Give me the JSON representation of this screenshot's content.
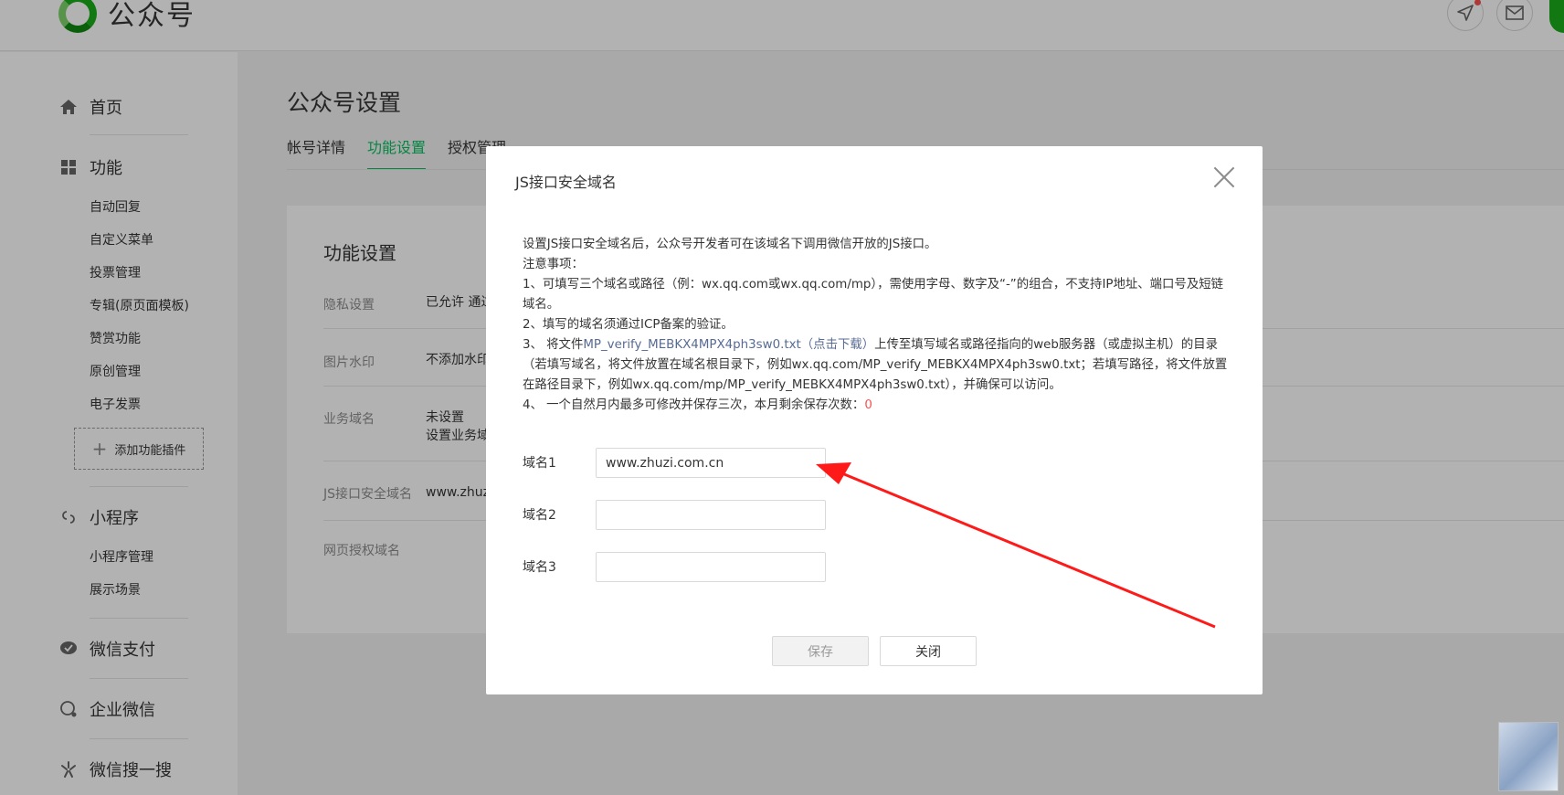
{
  "header": {
    "logo_text": "公众号",
    "icons": [
      "send-icon",
      "mail-icon"
    ]
  },
  "sidebar": {
    "sections": [
      {
        "label": "首页",
        "icon": "home-icon"
      },
      {
        "label": "功能",
        "icon": "grid-icon",
        "items": [
          "自动回复",
          "自定义菜单",
          "投票管理",
          "专辑(原页面模板)",
          "赞赏功能",
          "原创管理",
          "电子发票"
        ]
      },
      {
        "label": "小程序",
        "icon": "link-icon",
        "items": [
          "小程序管理",
          "展示场景"
        ]
      },
      {
        "label": "微信支付",
        "icon": "pay-icon"
      },
      {
        "label": "企业微信",
        "icon": "chat-icon"
      },
      {
        "label": "微信搜一搜",
        "icon": "search-star-icon"
      }
    ],
    "add_plugin_label": "添加功能插件"
  },
  "main": {
    "title": "公众号设置",
    "tabs": [
      "帐号详情",
      "功能设置",
      "授权管理"
    ],
    "active_tab": 1,
    "panel_title": "功能设置",
    "rows": [
      {
        "label": "隐私设置",
        "value": "已允许 通过"
      },
      {
        "label": "图片水印",
        "value": "不添加水印"
      },
      {
        "label": "业务域名",
        "value": "未设置",
        "value2": "设置业务域"
      },
      {
        "label": "JS接口安全域名",
        "value": "www.zhuz"
      },
      {
        "label": "网页授权域名",
        "value": ""
      }
    ]
  },
  "dialog": {
    "title": "JS接口安全域名",
    "intro": "设置JS接口安全域名后，公众号开发者可在该域名下调用微信开放的JS接口。",
    "notes_heading": "注意事项：",
    "note1": "1、可填写三个域名或路径（例：wx.qq.com或wx.qq.com/mp），需使用字母、数字及“-”的组合，不支持IP地址、端口号及短链域名。",
    "note2": "2、填写的域名须通过ICP备案的验证。",
    "note3_prefix": "3、 将文件",
    "note3_file": "MP_verify_MEBKX4MPX4ph3sw0.txt（点击下载）",
    "note3_suffix": "上传至填写域名或路径指向的web服务器（或虚拟主机）的目录（若填写域名，将文件放置在域名根目录下，例如wx.qq.com/MP_verify_MEBKX4MPX4ph3sw0.txt；若填写路径，将文件放置在路径目录下，例如wx.qq.com/mp/MP_verify_MEBKX4MPX4ph3sw0.txt），并确保可以访问。",
    "note4_prefix": "4、 一个自然月内最多可修改并保存三次，本月剩余保存次数：",
    "note4_count": "0",
    "fields": [
      {
        "label": "域名1",
        "value": "www.zhuzi.com.cn"
      },
      {
        "label": "域名2",
        "value": ""
      },
      {
        "label": "域名3",
        "value": ""
      }
    ],
    "save_label": "保存",
    "close_label": "关闭",
    "annotation_color": "#ff1a1a"
  }
}
